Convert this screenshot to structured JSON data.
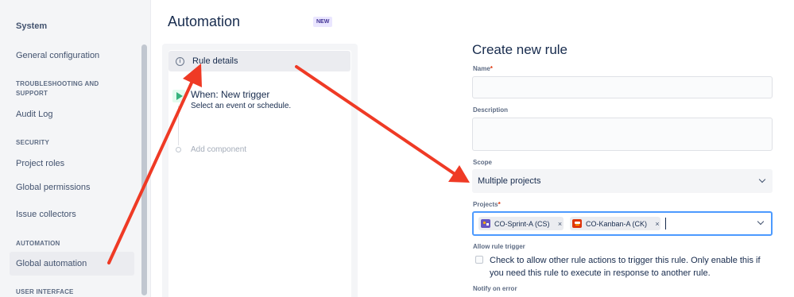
{
  "sidebar": {
    "title": "System",
    "items": {
      "general_configuration": "General configuration",
      "audit_log": "Audit Log",
      "project_roles": "Project roles",
      "global_permissions": "Global permissions",
      "issue_collectors": "Issue collectors",
      "global_automation": "Global automation"
    },
    "sections": {
      "troubleshooting": "TROUBLESHOOTING AND SUPPORT",
      "security": "SECURITY",
      "automation": "AUTOMATION",
      "user_interface": "USER INTERFACE"
    }
  },
  "header": {
    "title": "Automation",
    "badge": "NEW"
  },
  "rule_panel": {
    "rule_details": "Rule details",
    "trigger_title": "When: New trigger",
    "trigger_subtitle": "Select an event or schedule.",
    "add_component": "Add component"
  },
  "form": {
    "title": "Create new rule",
    "name_label": "Name",
    "name_required": "*",
    "description_label": "Description",
    "scope_label": "Scope",
    "scope_value": "Multiple projects",
    "projects_label": "Projects",
    "projects_required": "*",
    "projects": [
      {
        "name": "CO-Sprint-A (CS)",
        "remove": "×"
      },
      {
        "name": "CO-Kanban-A (CK)",
        "remove": "×"
      }
    ],
    "allow_trigger_label": "Allow rule trigger",
    "allow_trigger_text": "Check to allow other rule actions to trigger this rule. Only enable this if you need this rule to execute in response to another rule.",
    "notify_label": "Notify on error"
  },
  "icons": {
    "info": "info-icon",
    "trigger": "play-icon",
    "chevron": "chevron-down-icon",
    "sprint_project": "sprint-project-icon",
    "kanban_project": "kanban-project-icon"
  },
  "colors": {
    "annotation_arrow": "#ef3a25",
    "focus_border": "#4c9aff",
    "trigger_green": "#36b37e",
    "badge_bg": "#eae6ff",
    "badge_text": "#403294"
  }
}
